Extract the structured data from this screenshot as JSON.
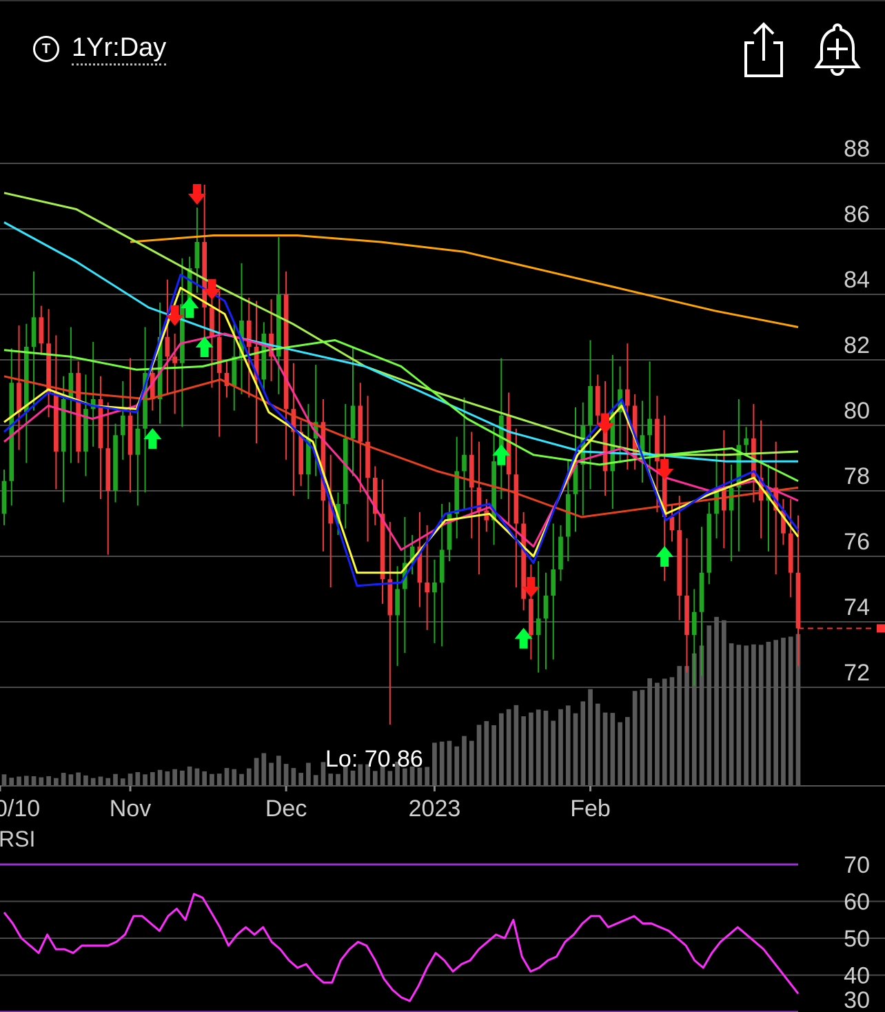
{
  "toolbar": {
    "timeframe_label": "1Yr:Day",
    "timeframe_icon": "clock-t-icon",
    "share_icon": "share-icon",
    "alert_icon": "add-alert-bell-icon"
  },
  "chart_data": [
    {
      "type": "candlestick",
      "y_ticks": [
        88,
        86,
        84,
        82,
        80,
        78,
        76,
        74,
        72
      ],
      "ylim": [
        70.1,
        89.0
      ],
      "x_tick_labels": [
        "0/10",
        "Nov",
        "Dec",
        "2023",
        "Feb"
      ],
      "x_tick_index": [
        0,
        17,
        38,
        58,
        79
      ],
      "low_annotation": "Lo: 70.86",
      "last_price": 73.8,
      "colors": {
        "up": "#1fa51f",
        "down": "#f2383a",
        "buy_arrow": "#00ff3c",
        "sell_arrow": "#ff1a1a"
      },
      "closes": [
        78.3,
        81.3,
        80.4,
        82.4,
        83.3,
        82.5,
        81.0,
        79.2,
        80.8,
        81.6,
        79.2,
        80.5,
        80.8,
        79.3,
        78.0,
        79.7,
        80.3,
        79.1,
        79.9,
        81.6,
        80.8,
        82.7,
        82.1,
        81.9,
        83.7,
        84.8,
        85.6,
        83.6,
        82.7,
        81.6,
        81.2,
        82.1,
        83.2,
        82.4,
        81.4,
        82.8,
        82.1,
        84.0,
        80.5,
        79.8,
        78.5,
        79.6,
        80.1,
        77.7,
        77.0,
        77.6,
        79.6,
        80.6,
        79.5,
        78.4,
        77.3,
        75.3,
        74.2,
        75.0,
        75.8,
        76.3,
        75.2,
        74.9,
        75.2,
        76.2,
        77.3,
        78.6,
        79.1,
        78.1,
        77.4,
        77.1,
        78.9,
        80.3,
        78.5,
        77.0,
        74.7,
        73.6,
        74.1,
        74.8,
        75.6,
        76.6,
        77.9,
        78.8,
        80.0,
        81.2,
        80.3,
        78.6,
        80.4,
        81.1,
        80.6,
        79.0,
        79.7,
        80.2,
        78.9,
        77.2,
        76.8,
        74.8,
        73.6,
        74.3,
        75.5,
        77.3,
        78.1,
        77.4,
        78.1,
        79.4,
        79.6,
        78.4,
        77.7,
        78.1,
        77.4,
        76.7,
        75.5,
        73.8
      ],
      "volumes": [
        0.31,
        0.22,
        0.25,
        0.27,
        0.26,
        0.23,
        0.26,
        0.21,
        0.35,
        0.31,
        0.36,
        0.28,
        0.21,
        0.25,
        0.21,
        0.32,
        0.2,
        0.33,
        0.37,
        0.31,
        0.37,
        0.43,
        0.39,
        0.45,
        0.41,
        0.52,
        0.47,
        0.39,
        0.32,
        0.33,
        0.48,
        0.45,
        0.32,
        0.47,
        0.75,
        0.88,
        0.62,
        0.81,
        0.59,
        0.48,
        0.35,
        0.62,
        0.29,
        0.64,
        0.33,
        0.32,
        0.56,
        0.41,
        0.58,
        0.58,
        0.4,
        0.56,
        0.4,
        0.65,
        0.47,
        0.52,
        0.49,
        0.51,
        1.16,
        1.19,
        1.21,
        1.06,
        1.34,
        1.21,
        1.64,
        1.74,
        1.63,
        1.95,
        2.06,
        2.17,
        1.87,
        1.97,
        2.05,
        2.02,
        1.75,
        2.06,
        2.16,
        1.95,
        2.27,
        2.6,
        2.21,
        1.97,
        1.96,
        1.71,
        1.85,
        2.55,
        2.58,
        2.89,
        2.77,
        2.88,
        2.92,
        3.22,
        3.22,
        3.56,
        3.77,
        4.31,
        4.54,
        4.45,
        3.83,
        3.79,
        3.77,
        3.8,
        3.79,
        3.87,
        3.92,
        3.98,
        4.01,
        4.08
      ],
      "volume_max": 5.0,
      "ma_lines": [
        {
          "color": "#ffa500",
          "start_index": 17,
          "values": [
            85.6,
            85.8,
            85.8,
            85.6,
            85.3,
            84.7,
            84.1,
            83.5,
            83.0
          ]
        },
        {
          "color": "#a5f04a",
          "values": [
            87.1,
            86.6,
            85.4,
            84.2,
            83.1,
            81.8,
            81.0,
            80.3,
            79.6,
            79.1,
            79.1,
            79.2
          ]
        },
        {
          "color": "#33e6ff",
          "values": [
            86.2,
            85.0,
            83.6,
            82.8,
            82.3,
            81.8,
            80.8,
            79.8,
            79.2,
            79.1,
            78.9,
            78.9
          ]
        },
        {
          "color": "#72ff3d",
          "values": [
            82.3,
            82.1,
            81.7,
            81.8,
            82.3,
            82.6,
            81.8,
            80.2,
            79.1,
            78.8,
            79.1,
            79.3,
            78.3
          ]
        },
        {
          "color": "#e8401f",
          "values": [
            81.5,
            81.0,
            80.8,
            81.4,
            80.3,
            79.4,
            78.6,
            78.0,
            77.2,
            77.5,
            77.8,
            78.1
          ]
        },
        {
          "color": "#ff2e98",
          "values": [
            79.5,
            80.6,
            80.2,
            80.6,
            82.5,
            82.8,
            82.4,
            79.9,
            78.4,
            76.2,
            77.0,
            77.5,
            76.3,
            78.9,
            79.3,
            78.4,
            78.0,
            78.3,
            77.7
          ]
        },
        {
          "color": "#ffff33",
          "values": [
            80.1,
            81.1,
            80.6,
            80.5,
            84.2,
            83.4,
            80.4,
            79.5,
            75.5,
            75.5,
            77.1,
            77.3,
            76.0,
            79.1,
            80.6,
            77.3,
            77.9,
            78.4,
            76.6
          ]
        },
        {
          "color": "#1521ff",
          "values": [
            79.8,
            81.0,
            80.6,
            80.4,
            84.6,
            83.8,
            80.7,
            79.3,
            75.1,
            75.2,
            77.3,
            77.6,
            75.8,
            79.3,
            80.8,
            77.1,
            78.0,
            78.6,
            76.8
          ]
        }
      ],
      "buy_signal_index": [
        20,
        25,
        27,
        67,
        70,
        89
      ],
      "sell_signal_index": [
        23,
        26,
        28,
        71,
        81,
        89
      ]
    },
    {
      "type": "line",
      "title": "RSI",
      "y_ticks": [
        70,
        60,
        50,
        40,
        30
      ],
      "ylim": [
        30,
        70
      ],
      "color": "#ff2bff",
      "values": [
        57.0,
        54.0,
        50.0,
        48.0,
        46.0,
        51.0,
        47.0,
        47.0,
        46.0,
        48.0,
        48.0,
        48.0,
        48.0,
        49.0,
        51.0,
        56.0,
        56.0,
        54.0,
        52.0,
        56.0,
        58.0,
        55.0,
        62.0,
        61.0,
        57.0,
        53.0,
        48.0,
        51.0,
        53.0,
        51.0,
        53.0,
        49.0,
        47.0,
        44.0,
        42.0,
        43.0,
        40.0,
        38.0,
        38.0,
        44.0,
        47.0,
        49.0,
        48.0,
        44.0,
        39.0,
        36.0,
        34.0,
        33.0,
        37.0,
        42.0,
        46.0,
        44.0,
        41.0,
        43.0,
        44.0,
        47.0,
        49.0,
        51.0,
        50.0,
        55.0,
        45.0,
        41.0,
        42.0,
        44.0,
        45.0,
        49.0,
        51.0,
        54.0,
        56.0,
        56.0,
        53.0,
        54.0,
        55.0,
        56.0,
        54.0,
        54.0,
        53.0,
        52.0,
        50.0,
        48.0,
        44.0,
        42.0,
        46.0,
        49.0,
        51.0,
        53.0,
        51.0,
        49.0,
        47.0,
        44.0,
        41.0,
        38.0,
        35.0
      ]
    }
  ]
}
